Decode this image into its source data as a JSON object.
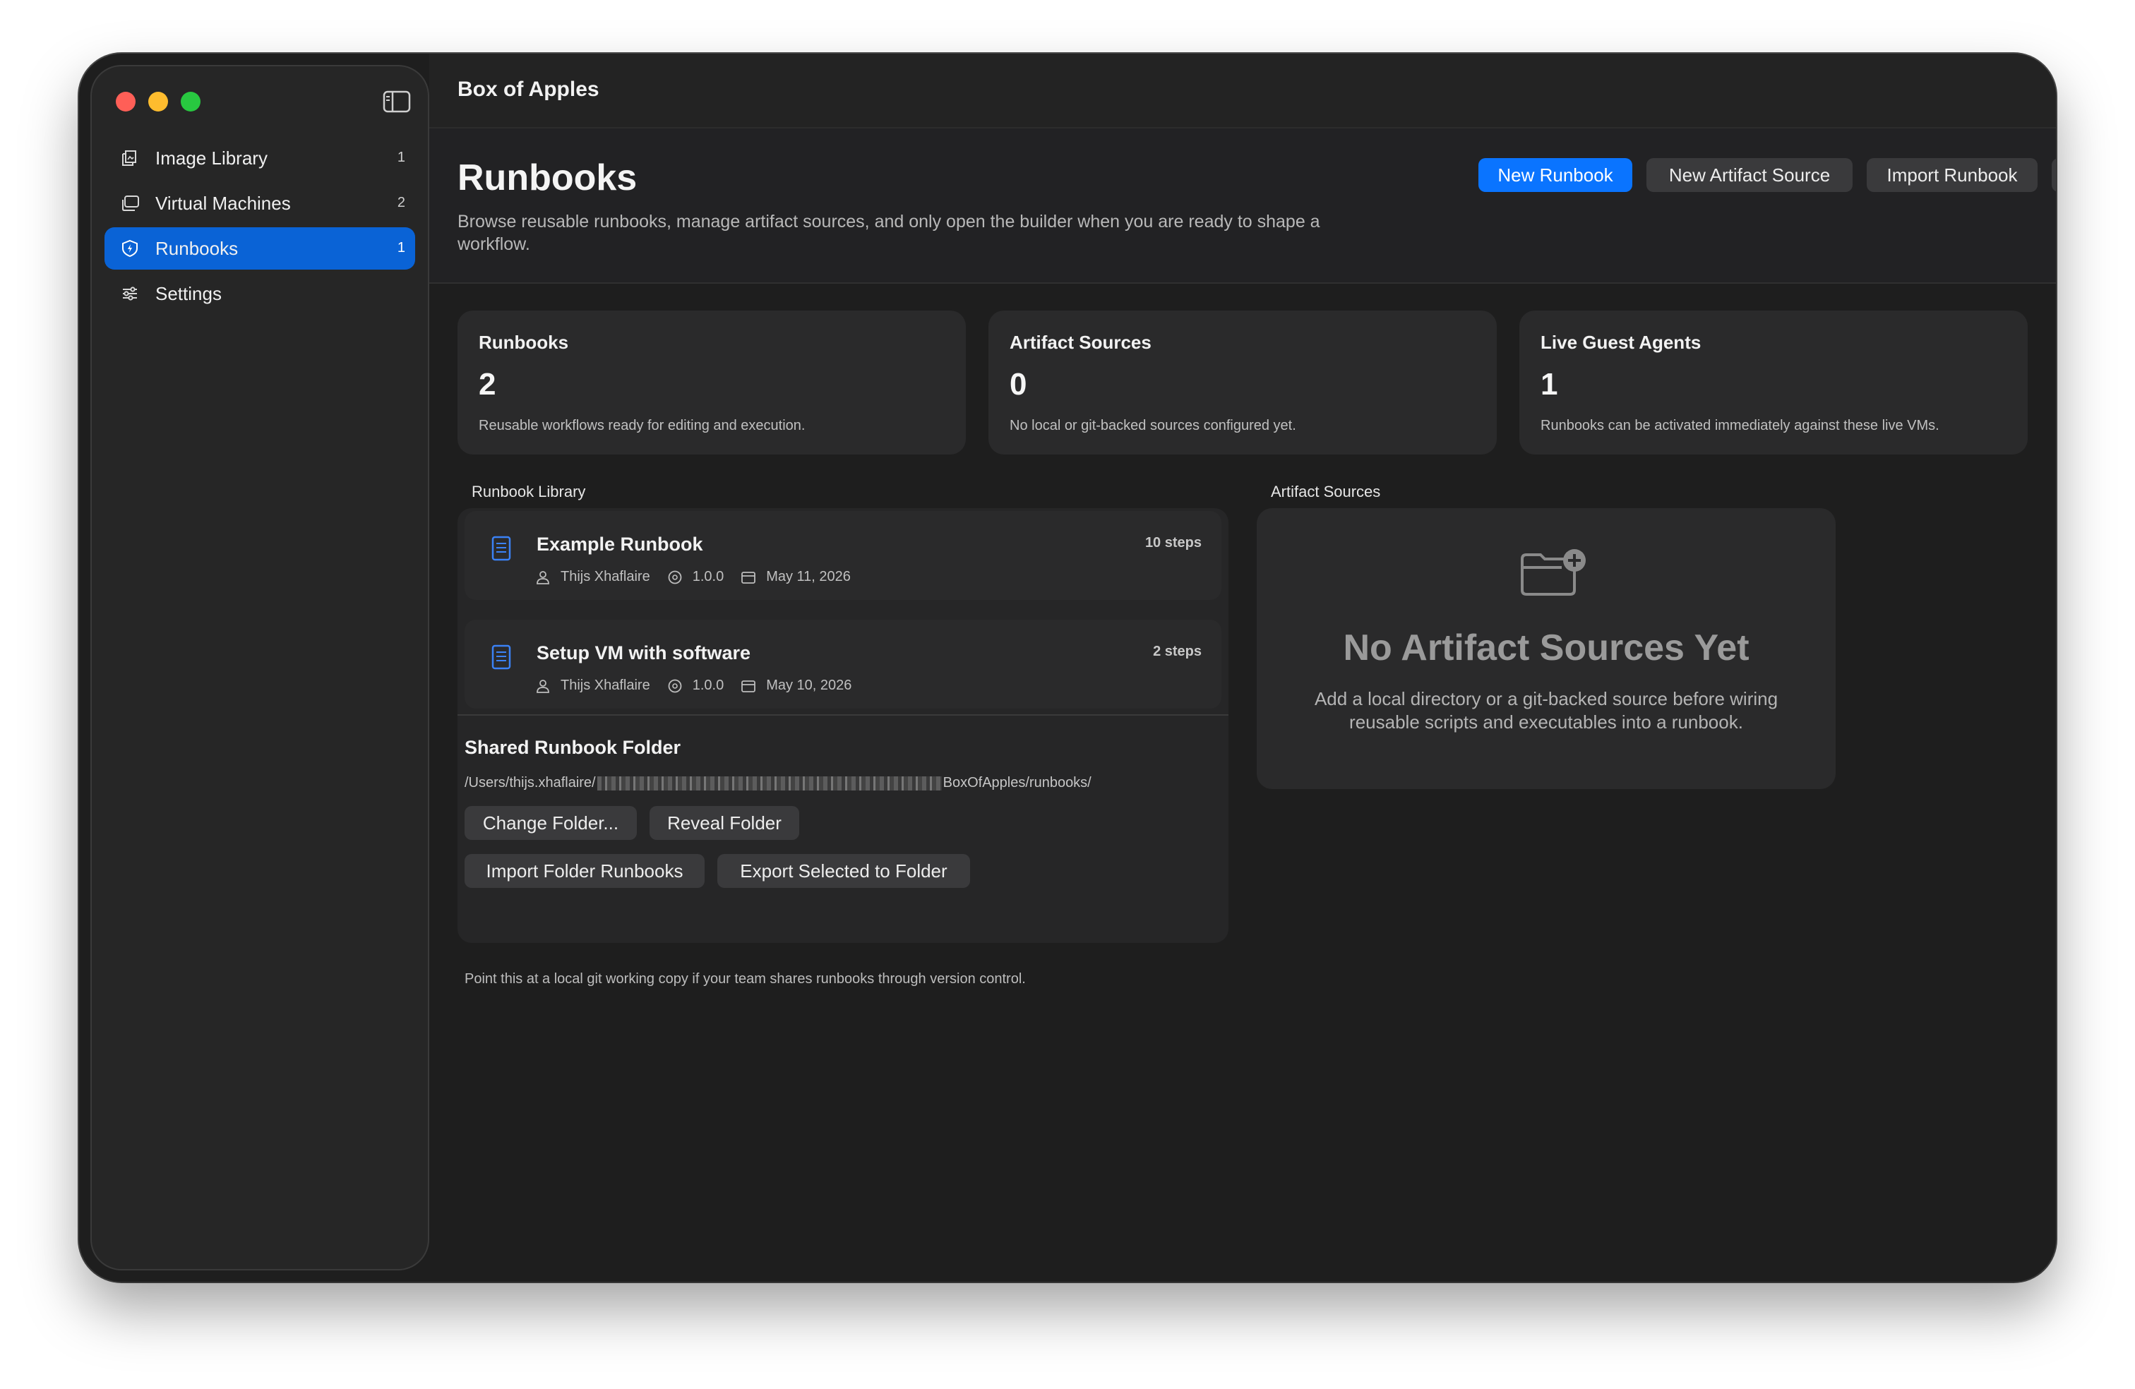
{
  "app": {
    "title": "Box of Apples"
  },
  "sidebar": {
    "items": [
      {
        "label": "Image Library",
        "count": "1",
        "icon": "image-library-icon"
      },
      {
        "label": "Virtual Machines",
        "count": "2",
        "icon": "virtual-machines-icon"
      },
      {
        "label": "Runbooks",
        "count": "1",
        "icon": "runbooks-icon",
        "active": true
      },
      {
        "label": "Settings",
        "count": "",
        "icon": "settings-sliders-icon"
      }
    ]
  },
  "header": {
    "title": "Runbooks",
    "subtitle": "Browse reusable runbooks, manage artifact sources, and only open the builder when you are ready to shape a workflow.",
    "buttons": {
      "new_runbook": "New Runbook",
      "new_artifact_source": "New Artifact Source",
      "import_runbook": "Import Runbook",
      "help": "?"
    }
  },
  "stats": [
    {
      "title": "Runbooks",
      "value": "2",
      "desc": "Reusable workflows ready for editing and execution."
    },
    {
      "title": "Artifact Sources",
      "value": "0",
      "desc": "No local or git-backed sources configured yet."
    },
    {
      "title": "Live Guest Agents",
      "value": "1",
      "desc": "Runbooks can be activated immediately against these live VMs."
    }
  ],
  "library": {
    "label": "Runbook Library",
    "runbooks": [
      {
        "name": "Example Runbook",
        "steps": "10 steps",
        "author": "Thijs Xhaflaire",
        "version": "1.0.0",
        "date": "May 11, 2026"
      },
      {
        "name": "Setup VM with software",
        "steps": "2 steps",
        "author": "Thijs Xhaflaire",
        "version": "1.0.0",
        "date": "May 10, 2026"
      }
    ],
    "shared_folder": {
      "title": "Shared Runbook Folder",
      "path_prefix": "/Users/thijs.xhaflaire/",
      "path_suffix": "BoxOfApples/runbooks/",
      "buttons": {
        "change_folder": "Change Folder...",
        "reveal_folder": "Reveal Folder",
        "import_folder_runbooks": "Import Folder Runbooks",
        "export_selected": "Export Selected to Folder"
      },
      "hint": "Point this at a local git working copy if your team shares runbooks through version control."
    }
  },
  "artifact_sources": {
    "label": "Artifact Sources",
    "empty_title": "No Artifact Sources Yet",
    "empty_desc": "Add a local directory or a git-backed source before wiring reusable scripts and executables into a runbook."
  },
  "colors": {
    "accent": "#0a74ff",
    "sidebar_active": "#0a63d6",
    "background": "#1e1e1e",
    "card": "#2a2a2b",
    "runbook_icon": "#3b82f6"
  }
}
